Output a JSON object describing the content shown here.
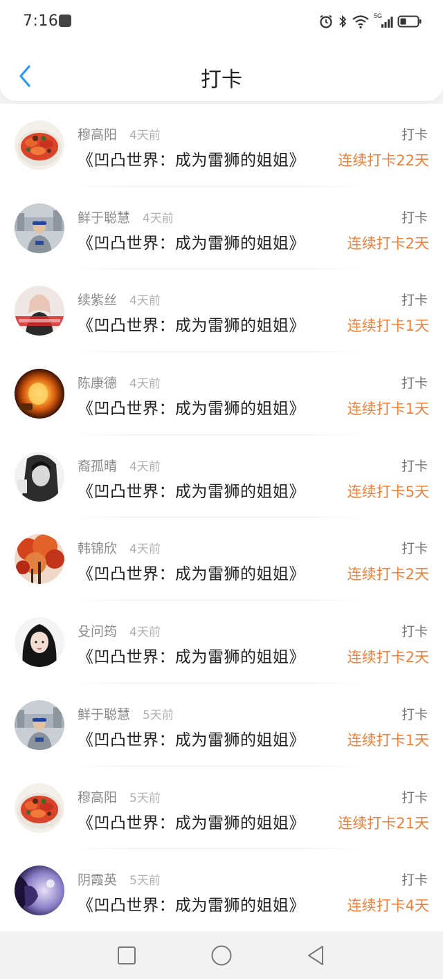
{
  "status_bar": {
    "time": "7:16",
    "network_label": "5G",
    "icons": [
      "message-icon",
      "alarm-icon",
      "bluetooth-icon",
      "wifi-icon",
      "cellular-signal-icon",
      "battery-icon"
    ]
  },
  "header": {
    "title": "打卡",
    "back_icon": "chevron-left-icon"
  },
  "colors": {
    "accent_blue": "#2a9af0",
    "streak_orange": "#f0803a"
  },
  "entries": [
    {
      "user": "穆高阳",
      "time": "4天前",
      "book": "《凹凸世界：成为雷狮的姐姐》",
      "action": "打卡",
      "streak": "连续打卡22天",
      "avatar": "food-avatar"
    },
    {
      "user": "鲜于聪慧",
      "time": "4天前",
      "book": "《凹凸世界：成为雷狮的姐姐》",
      "action": "打卡",
      "streak": "连续打卡2天",
      "avatar": "man-photo-avatar"
    },
    {
      "user": "续紫丝",
      "time": "4天前",
      "book": "《凹凸世界：成为雷狮的姐姐》",
      "action": "打卡",
      "streak": "连续打卡1天",
      "avatar": "girl-red-text-avatar"
    },
    {
      "user": "陈康德",
      "time": "4天前",
      "book": "《凹凸世界：成为雷狮的姐姐》",
      "action": "打卡",
      "streak": "连续打卡1天",
      "avatar": "light-bulb-avatar"
    },
    {
      "user": "裔孤晴",
      "time": "4天前",
      "book": "《凹凸世界：成为雷狮的姐姐》",
      "action": "打卡",
      "streak": "连续打卡5天",
      "avatar": "bw-girl-avatar"
    },
    {
      "user": "韩锦欣",
      "time": "4天前",
      "book": "《凹凸世界：成为雷狮的姐姐》",
      "action": "打卡",
      "streak": "连续打卡2天",
      "avatar": "autumn-tree-avatar"
    },
    {
      "user": "殳问筠",
      "time": "4天前",
      "book": "《凹凸世界：成为雷狮的姐姐》",
      "action": "打卡",
      "streak": "连续打卡2天",
      "avatar": "girl-portrait-avatar"
    },
    {
      "user": "鲜于聪慧",
      "time": "5天前",
      "book": "《凹凸世界：成为雷狮的姐姐》",
      "action": "打卡",
      "streak": "连续打卡1天",
      "avatar": "man-photo-avatar"
    },
    {
      "user": "穆高阳",
      "time": "5天前",
      "book": "《凹凸世界：成为雷狮的姐姐》",
      "action": "打卡",
      "streak": "连续打卡21天",
      "avatar": "food-avatar"
    },
    {
      "user": "阴霞英",
      "time": "5天前",
      "book": "《凹凸世界：成为雷狮的姐姐》",
      "action": "打卡",
      "streak": "连续打卡4天",
      "avatar": "purple-anime-avatar"
    }
  ],
  "nav_bar": {
    "buttons": [
      "recent-apps-icon",
      "home-icon",
      "back-triangle-icon"
    ]
  }
}
